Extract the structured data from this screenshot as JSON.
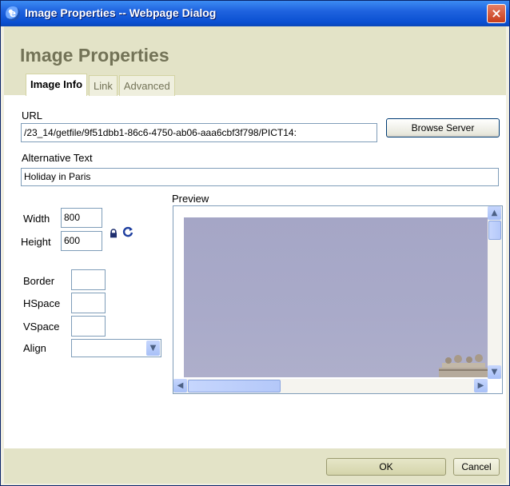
{
  "window": {
    "title": "Image Properties -- Webpage Dialog",
    "close_label": "×",
    "app_icon": "ie-icon"
  },
  "dialog": {
    "heading": "Image Properties",
    "tabs": [
      {
        "label": "Image Info",
        "active": true
      },
      {
        "label": "Link",
        "active": false
      },
      {
        "label": "Advanced",
        "active": false
      }
    ]
  },
  "image_info": {
    "url_label": "URL",
    "url_value": "/23_14/getfile/9f51dbb1-86c6-4750-ab06-aaa6cbf3f798/PICT14:",
    "browse_button": "Browse Server",
    "alt_label": "Alternative Text",
    "alt_value": "Holiday in Paris",
    "width_label": "Width",
    "width_value": "800",
    "height_label": "Height",
    "height_value": "600",
    "lock_icon": "lock-icon",
    "reset_icon": "reset-size-icon",
    "border_label": "Border",
    "border_value": "",
    "hspace_label": "HSpace",
    "hspace_value": "",
    "vspace_label": "VSpace",
    "vspace_value": "",
    "align_label": "Align",
    "align_value": "",
    "preview_label": "Preview"
  },
  "footer": {
    "ok_label": "OK",
    "cancel_label": "Cancel"
  },
  "colors": {
    "header_bg": "#e3e3c7",
    "titlebar": "#0a4fd1",
    "heading": "#737357"
  }
}
